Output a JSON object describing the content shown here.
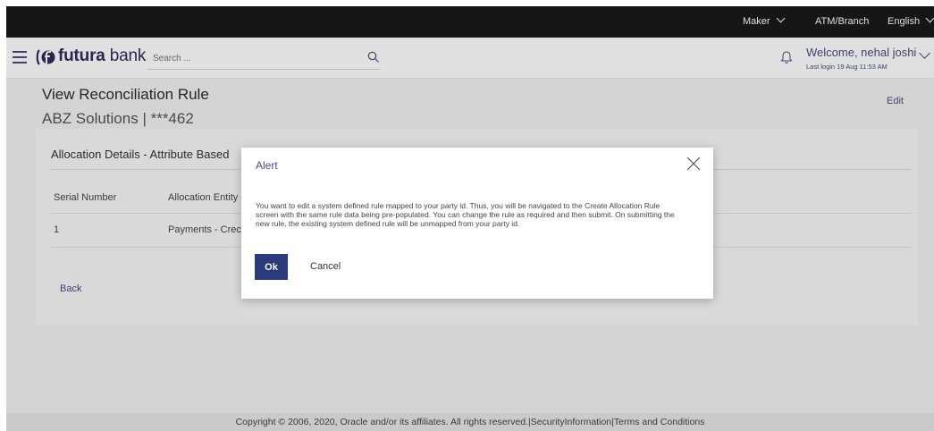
{
  "topbar": {
    "role": "Maker",
    "location": "ATM/Branch",
    "language": "English"
  },
  "header": {
    "logo_bold": "futura",
    "logo_rest": " bank",
    "search_placeholder": "Search ...",
    "welcome": "Welcome, nehal joshi",
    "last_login": "Last login 19 Aug 11:53 AM"
  },
  "page": {
    "title": "View Reconciliation Rule",
    "subtitle": "ABZ Solutions | ***462",
    "edit_label": "Edit"
  },
  "card": {
    "title": "Allocation Details - Attribute Based",
    "columns": [
      "Serial Number",
      "Allocation Entity"
    ],
    "rows": [
      {
        "serial": "1",
        "entity": "Payments - Crec"
      }
    ],
    "back_label": "Back"
  },
  "modal": {
    "title": "Alert",
    "body": "You want to edit a system defined rule mapped to your party id. Thus, you will be navigated to the Create Allocation Rule screen with the same rule data being pre-populated. You can change the rule as required and then submit. On submitting the new rule, the existing system defined rule will be unmapped from your party id.",
    "ok_label": "Ok",
    "cancel_label": "Cancel"
  },
  "footer": {
    "text": "Copyright © 2006, 2020, Oracle and/or its affiliates. All rights reserved.|SecurityInformation|Terms and Conditions"
  },
  "colors": {
    "brand": "#2d2d5e",
    "accent": "#4a4a86",
    "button": "#2b3a7a"
  }
}
